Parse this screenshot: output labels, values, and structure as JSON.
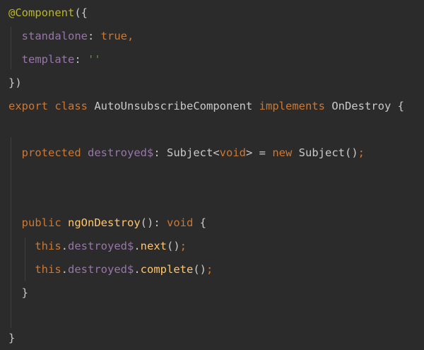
{
  "editor": {
    "language": "typescript",
    "theme_colors": {
      "background": "#2b2b2b",
      "keyword": "#cc7832",
      "decorator": "#bbb529",
      "property": "#9876aa",
      "string": "#6a8759",
      "function": "#ffc66d",
      "plain": "#c9c9c9"
    },
    "lines": [
      {
        "tokens": [
          {
            "text": "@Component",
            "kind": "decorator"
          },
          {
            "text": "({",
            "kind": "punct"
          }
        ]
      },
      {
        "tokens": [
          {
            "text": "  ",
            "kind": "plain"
          },
          {
            "text": "standalone",
            "kind": "prop"
          },
          {
            "text": ": ",
            "kind": "punct"
          },
          {
            "text": "true",
            "kind": "keyword"
          },
          {
            "text": ",",
            "kind": "keyword"
          }
        ]
      },
      {
        "tokens": [
          {
            "text": "  ",
            "kind": "plain"
          },
          {
            "text": "template",
            "kind": "prop"
          },
          {
            "text": ": ",
            "kind": "punct"
          },
          {
            "text": "''",
            "kind": "string"
          }
        ]
      },
      {
        "tokens": [
          {
            "text": "})",
            "kind": "punct"
          }
        ]
      },
      {
        "tokens": [
          {
            "text": "export",
            "kind": "keyword"
          },
          {
            "text": " ",
            "kind": "plain"
          },
          {
            "text": "class",
            "kind": "keyword"
          },
          {
            "text": " AutoUnsubscribeComponent ",
            "kind": "plain"
          },
          {
            "text": "implements",
            "kind": "keyword"
          },
          {
            "text": " OnDestroy {",
            "kind": "plain"
          }
        ]
      },
      {
        "tokens": []
      },
      {
        "tokens": [
          {
            "text": "  ",
            "kind": "plain"
          },
          {
            "text": "protected",
            "kind": "keyword"
          },
          {
            "text": " ",
            "kind": "plain"
          },
          {
            "text": "destroyed$",
            "kind": "prop"
          },
          {
            "text": ": Subject<",
            "kind": "plain"
          },
          {
            "text": "void",
            "kind": "keyword"
          },
          {
            "text": "> = ",
            "kind": "plain"
          },
          {
            "text": "new",
            "kind": "keyword"
          },
          {
            "text": " Subject()",
            "kind": "plain"
          },
          {
            "text": ";",
            "kind": "keyword"
          }
        ]
      },
      {
        "tokens": []
      },
      {
        "tokens": []
      },
      {
        "tokens": [
          {
            "text": "  ",
            "kind": "plain"
          },
          {
            "text": "public",
            "kind": "keyword"
          },
          {
            "text": " ",
            "kind": "plain"
          },
          {
            "text": "ngOnDestroy",
            "kind": "func"
          },
          {
            "text": "(): ",
            "kind": "plain"
          },
          {
            "text": "void",
            "kind": "keyword"
          },
          {
            "text": " {",
            "kind": "plain"
          }
        ]
      },
      {
        "tokens": [
          {
            "text": "    ",
            "kind": "plain"
          },
          {
            "text": "this",
            "kind": "keyword"
          },
          {
            "text": ".",
            "kind": "plain"
          },
          {
            "text": "destroyed$",
            "kind": "prop"
          },
          {
            "text": ".",
            "kind": "plain"
          },
          {
            "text": "next",
            "kind": "func"
          },
          {
            "text": "()",
            "kind": "plain"
          },
          {
            "text": ";",
            "kind": "keyword"
          }
        ]
      },
      {
        "tokens": [
          {
            "text": "    ",
            "kind": "plain"
          },
          {
            "text": "this",
            "kind": "keyword"
          },
          {
            "text": ".",
            "kind": "plain"
          },
          {
            "text": "destroyed$",
            "kind": "prop"
          },
          {
            "text": ".",
            "kind": "plain"
          },
          {
            "text": "complete",
            "kind": "func"
          },
          {
            "text": "()",
            "kind": "plain"
          },
          {
            "text": ";",
            "kind": "keyword"
          }
        ]
      },
      {
        "tokens": [
          {
            "text": "  }",
            "kind": "plain"
          }
        ]
      },
      {
        "tokens": []
      },
      {
        "tokens": [
          {
            "text": "}",
            "kind": "plain"
          }
        ]
      }
    ]
  }
}
